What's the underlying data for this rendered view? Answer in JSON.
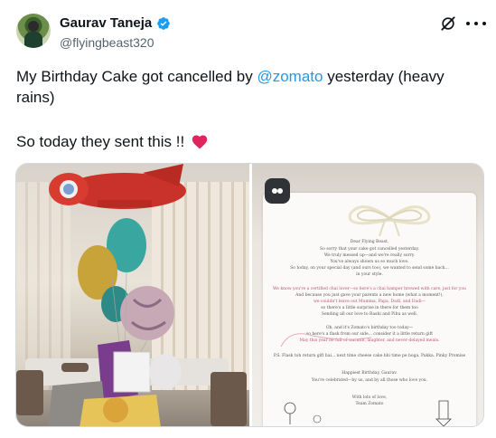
{
  "author": {
    "name": "Gaurav Taneja",
    "handle": "@flyingbeast320",
    "verified_icon": "verified-badge-icon",
    "avatar_icon": "avatar"
  },
  "post": {
    "text_before": "My Birthday Cake got cancelled by ",
    "mention": "@zomato",
    "text_after": " yesterday (heavy rains)",
    "line2": "So today they sent this !! ",
    "heart_icon": "red-heart-icon"
  },
  "media": {
    "photo_left_desc_icon": "balloons-photo",
    "photo_right_desc_icon": "letter-photo",
    "letter_lines": [
      "Dear Flying Beast,",
      "So sorry that your cake got cancelled yesterday.",
      "We truly messed up—and we're really sorry.",
      "You've always shown us so much love.",
      "So today, on your special day (and ours too), we wanted to send some back...",
      "in your style.",
      "We know you're a certified chai lover—so here's a chai hamper brewed with care, just for you",
      "And because you just gave your parents a new home (what a moment!),",
      "we couldn't leave out Mumma, Papa, Dadi, and Dadi—",
      "so there's a little surprise in there for them too",
      "Sending all our love to Rashi and Pihu as well.",
      "Oh, and it's Zomato's birthday too today—",
      "so here's a flask from our side... consider it a little return gift",
      "May this year be full of warmth, laughter, and never-delayed meals.",
      "P.S. Flask toh return gift hai... next time cheese cake bhi time pe hoga. Pakka. Pinky Promise",
      "Happiest Birthday, Gaurav.",
      "You're celebrated—by us, and by all those who love you.",
      "With lots of love,",
      "Team Zomato"
    ],
    "pink_line_indices": [
      6,
      8,
      13
    ]
  },
  "colors": {
    "accent": "#1d9bf0",
    "text": "#0f1419",
    "muted": "#536471",
    "heart": "#e0245e"
  }
}
